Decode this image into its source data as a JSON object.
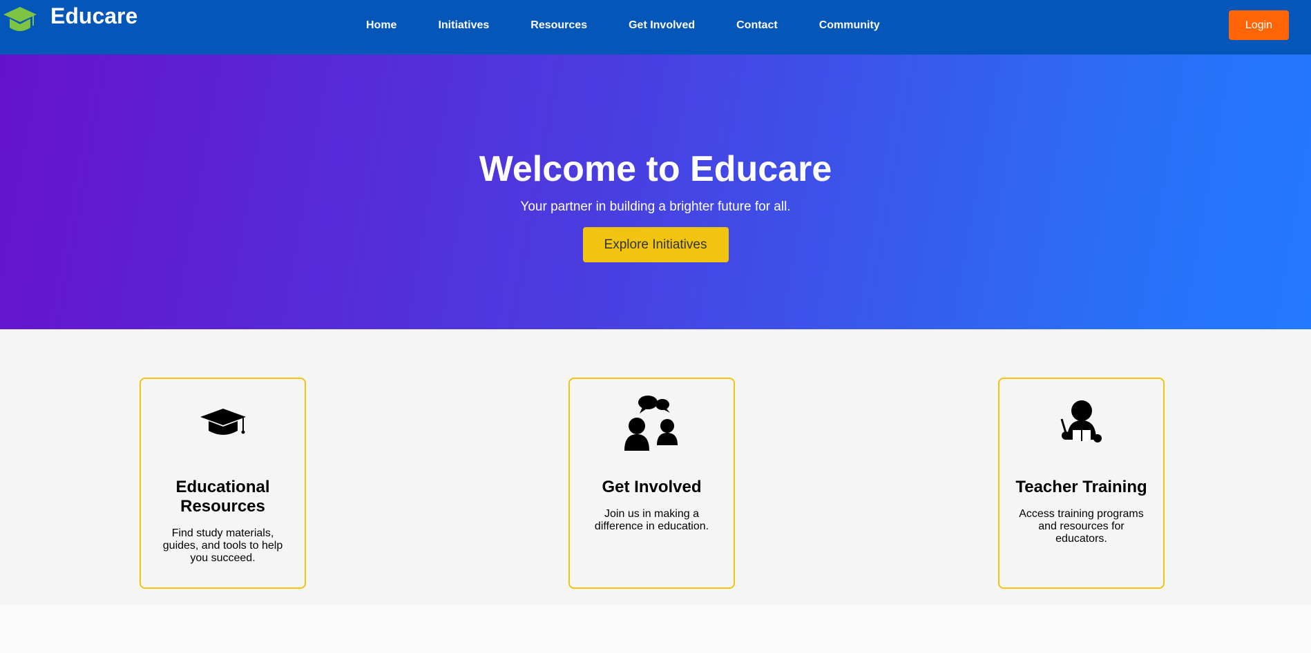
{
  "brand": {
    "name": "Educare",
    "icon": "graduation-cap-icon",
    "icon_color": "#7dc443"
  },
  "nav": {
    "links": [
      "Home",
      "Initiatives",
      "Resources",
      "Get Involved",
      "Contact",
      "Community"
    ],
    "login_label": "Login"
  },
  "hero": {
    "title": "Welcome to Educare",
    "subtitle": "Your partner in building a brighter future for all.",
    "cta_label": "Explore Initiatives"
  },
  "features": [
    {
      "icon": "graduation-cap-icon",
      "title": "Educational Resources",
      "description": "Find study materials, guides, and tools to help you succeed."
    },
    {
      "icon": "community-chat-icon",
      "title": "Get Involved",
      "description": "Join us in making a difference in education."
    },
    {
      "icon": "teacher-icon",
      "title": "Teacher Training",
      "description": "Access training programs and resources for educators."
    }
  ],
  "colors": {
    "navbar": "#0456b8",
    "login": "#ff6406",
    "hero_start": "#6612cc",
    "hero_end": "#2379ff",
    "cta": "#f1c40f",
    "card_border": "#f1c40f"
  }
}
